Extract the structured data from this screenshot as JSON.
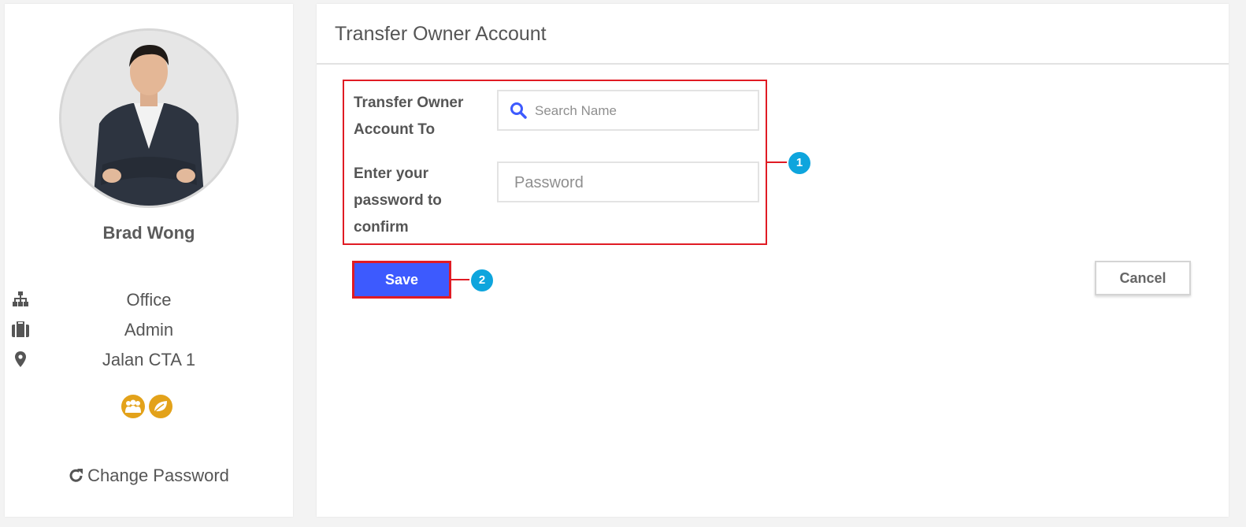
{
  "profile": {
    "name": "Brad Wong",
    "department": "Office",
    "role": "Admin",
    "location": "Jalan CTA 1",
    "department_icon": "sitemap-icon",
    "role_icon": "briefcase-icon",
    "location_icon": "map-marker-icon",
    "badges": [
      "group-badge-icon",
      "leaf-badge-icon"
    ],
    "badge_color": "#e3a21a",
    "change_password_label": "Change Password",
    "change_password_icon": "refresh-icon"
  },
  "transfer": {
    "title": "Transfer Owner Account",
    "to_label": "Transfer Owner Account To",
    "search_placeholder": "Search Name",
    "password_label": "Enter your password to confirm",
    "password_placeholder": "Password",
    "save_label": "Save",
    "cancel_label": "Cancel"
  },
  "callouts": [
    "1",
    "2"
  ],
  "colors": {
    "primary": "#3d5afe",
    "highlight": "#e01b24",
    "callout": "#0ea5dd"
  }
}
